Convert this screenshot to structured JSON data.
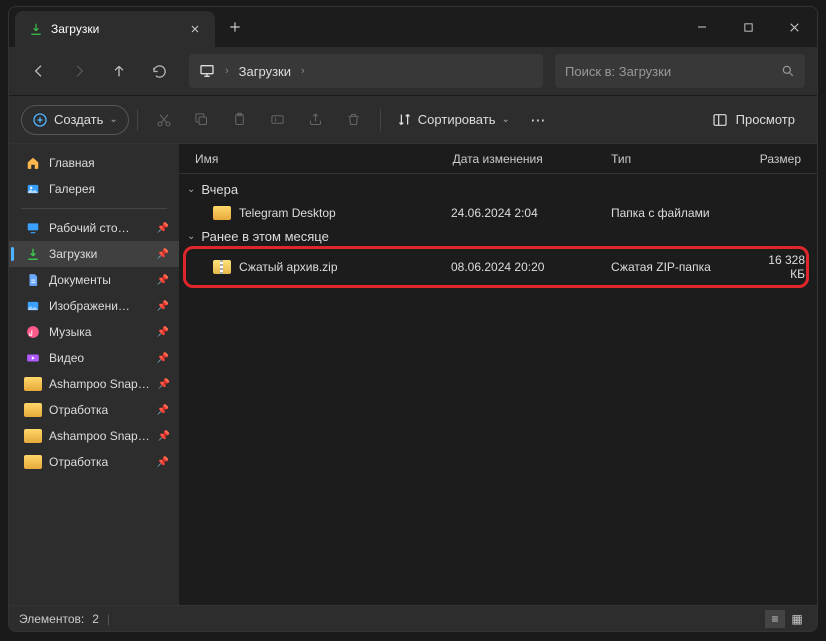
{
  "tab": {
    "title": "Загрузки"
  },
  "nav": {
    "location": "Загрузки"
  },
  "search": {
    "placeholder": "Поиск в: Загрузки"
  },
  "toolbar": {
    "create": "Создать",
    "sort": "Сортировать",
    "view": "Просмотр"
  },
  "columns": {
    "name": "Имя",
    "date": "Дата изменения",
    "type": "Тип",
    "size": "Размер"
  },
  "groups": [
    {
      "label": "Вчера",
      "items": [
        {
          "name": "Telegram Desktop",
          "date": "24.06.2024 2:04",
          "type": "Папка с файлами",
          "size": "",
          "icon": "folder"
        }
      ]
    },
    {
      "label": "Ранее в этом месяце",
      "items": [
        {
          "name": "Сжатый архив.zip",
          "date": "08.06.2024 20:20",
          "type": "Сжатая ZIP-папка",
          "size": "16 328 КБ",
          "icon": "zip",
          "highlight": true
        }
      ]
    }
  ],
  "sidebar": {
    "top": [
      {
        "label": "Главная",
        "icon": "home"
      },
      {
        "label": "Галерея",
        "icon": "gallery"
      }
    ],
    "pinned": [
      {
        "label": "Рабочий сто…",
        "icon": "desktop",
        "color": "#3aa0ff"
      },
      {
        "label": "Загрузки",
        "icon": "download",
        "color": "#3cc24e",
        "active": true
      },
      {
        "label": "Документы",
        "icon": "doc",
        "color": "#6aa8ff"
      },
      {
        "label": "Изображени…",
        "icon": "image",
        "color": "#3aa0ff"
      },
      {
        "label": "Музыка",
        "icon": "music",
        "color": "#ff5a8a"
      },
      {
        "label": "Видео",
        "icon": "video",
        "color": "#b05aff"
      },
      {
        "label": "Ashampoo Snap…",
        "icon": "folder"
      },
      {
        "label": "Отработка",
        "icon": "folder"
      },
      {
        "label": "Ashampoo Snap…",
        "icon": "folder"
      },
      {
        "label": "Отработка",
        "icon": "folder"
      }
    ]
  },
  "status": {
    "count_label": "Элементов:",
    "count": "2"
  }
}
